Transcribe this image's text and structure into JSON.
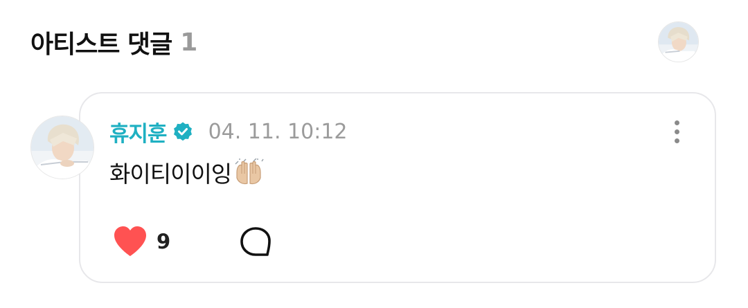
{
  "header": {
    "title": "아티스트 댓글",
    "count": "1",
    "avatar_icon": "artist-profile-avatar"
  },
  "comment": {
    "author": "휴지훈",
    "verified_icon": "verified-badge-icon",
    "timestamp": "04. 11. 10:12",
    "text": "화이티이이잉",
    "emoji": "raising-hands-emoji",
    "like_count": "9",
    "more_icon": "more-vertical-icon",
    "reply_icon": "speech-bubble-icon"
  },
  "colors": {
    "author": "#1fb0c2",
    "heart": "#ff5252",
    "timestamp": "#9b9b9b",
    "card_border": "#e7e7ea"
  }
}
